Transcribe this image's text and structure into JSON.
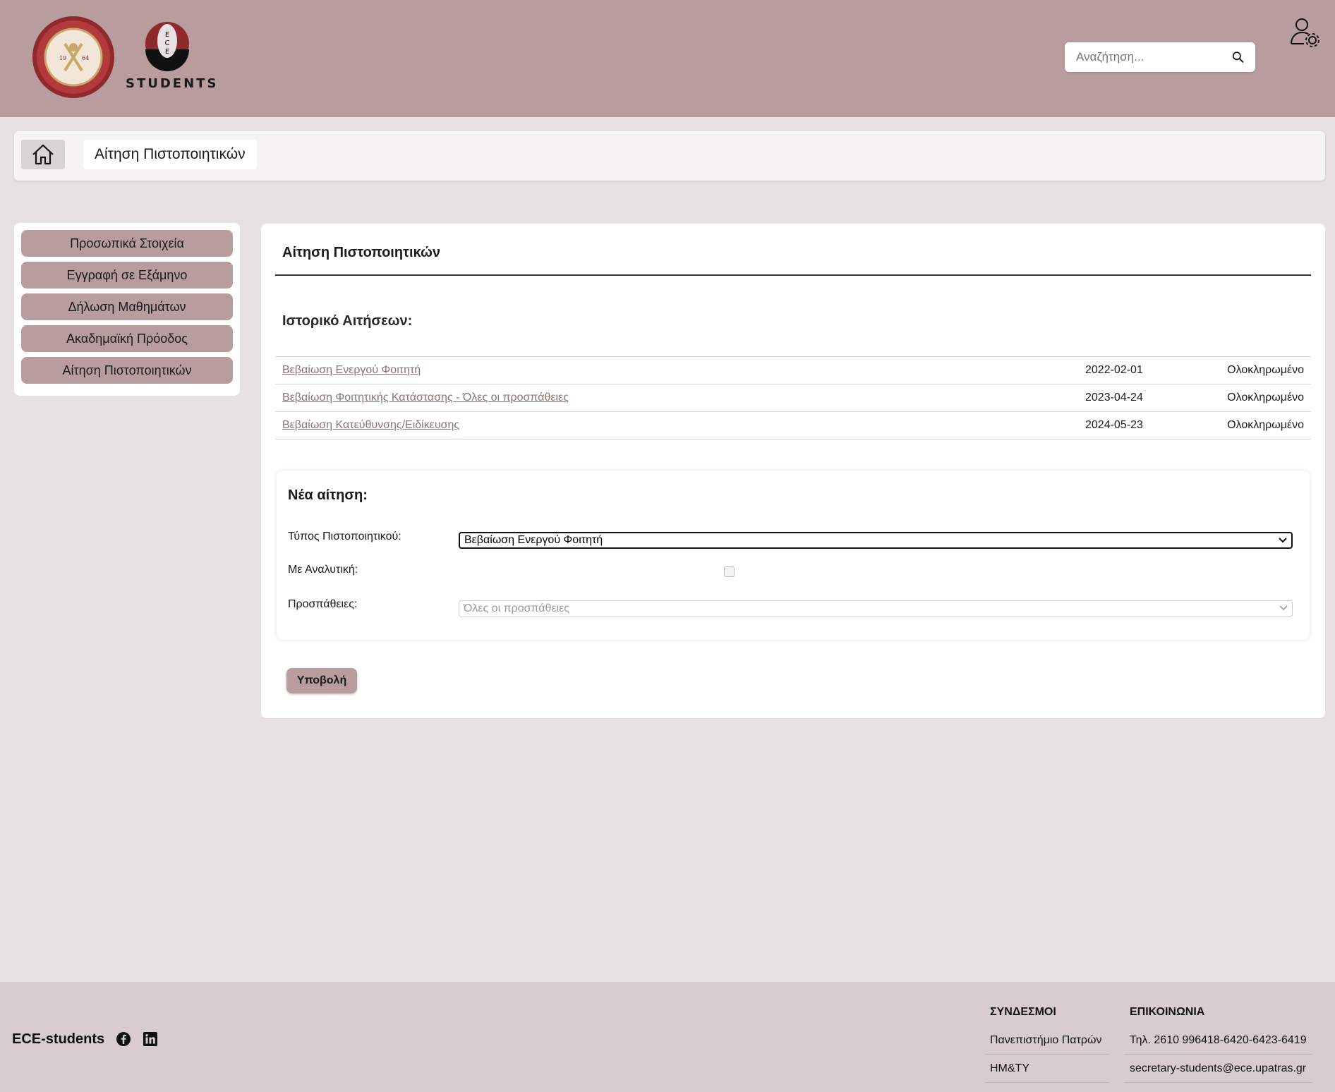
{
  "header": {
    "ece_logo_text": "STUDENTS",
    "ece_badge_letters": "E C E",
    "search_placeholder": "Αναζήτηση..."
  },
  "breadcrumb": {
    "current": "Αίτηση Πιστοποιητικών"
  },
  "sidebar": {
    "items": [
      {
        "label": "Προσωπικά Στοιχεία"
      },
      {
        "label": "Εγγραφή σε Εξάμηνο"
      },
      {
        "label": "Δήλωση Μαθημάτων"
      },
      {
        "label": "Ακαδημαϊκή Πρόοδος"
      },
      {
        "label": "Αίτηση Πιστοποιητικών"
      }
    ]
  },
  "main": {
    "title": "Αίτηση Πιστοποιητικών",
    "history_title": "Ιστορικό Αιτήσεων:",
    "history": [
      {
        "name": "Βεβαίωση Ενεργού Φοιτητή",
        "date": "2022-02-01",
        "status": "Ολοκληρωμένο"
      },
      {
        "name": "Βεβαίωση Φοιτητικής Κατάστασης - Όλες οι προσπάθειες",
        "date": "2023-04-24",
        "status": "Ολοκληρωμένο"
      },
      {
        "name": "Βεβαίωση Κατεύθυνσης/Ειδίκευσης",
        "date": "2024-05-23",
        "status": "Ολοκληρωμένο"
      }
    ],
    "new_request": {
      "title": "Νέα αίτηση:",
      "type_label": "Τύπος Πιστοποιητικού:",
      "type_value": "Βεβαίωση Ενεργού Φοιτητή",
      "analytic_label": "Με Αναλυτική:",
      "analytic_checked": false,
      "attempts_label": "Προσπάθειες:",
      "attempts_value": "Όλες οι προσπάθειες"
    },
    "submit_label": "Υποβολή"
  },
  "footer": {
    "brand": "ECE-students",
    "links_title": "ΣΥΝΔΕΣΜΟΙ",
    "links": [
      "Πανεπιστήμιο Πατρών",
      "ΗΜ&ΤΥ"
    ],
    "contact_title": "ΕΠΙΚΟΙΝΩΝΙΑ",
    "contact": [
      "Τηλ. 2610 996418-6420-6423-6419",
      "secretary-students@ece.upatras.gr"
    ]
  },
  "colors": {
    "accent": "#b99d9e",
    "page_bg": "#e8e1e1",
    "footer_bg": "#d9cccc",
    "link": "#8c7475"
  }
}
